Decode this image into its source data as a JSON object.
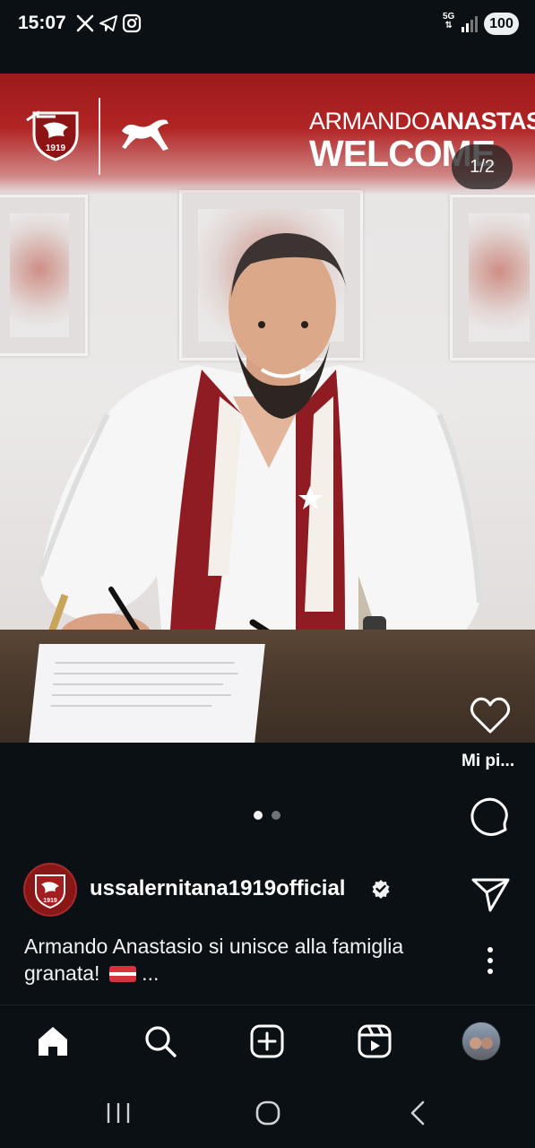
{
  "status_bar": {
    "time": "15:07",
    "network": "5G",
    "battery": "100",
    "icons": [
      "x-icon",
      "telegram-icon",
      "instagram-icon"
    ]
  },
  "post": {
    "image_counter": "1/2",
    "image_text": {
      "headline_first": "ARMANDO",
      "headline_last": "ANASTASIO",
      "headline_welcome": "WELCOME",
      "badge_year": "1919"
    },
    "like_label": "Mi pi...",
    "carousel": {
      "pages": 2,
      "active": 1
    },
    "author": "ussalernitana1919official",
    "caption_text": "Armando Anastasio si unisce alla famiglia granata!",
    "caption_more": " ..."
  },
  "nav": {
    "items": [
      "home-icon",
      "search-icon",
      "create-icon",
      "reels-icon",
      "profile-avatar"
    ]
  },
  "colors": {
    "background": "#0b1014",
    "club_red": "#9c1b1b",
    "text": "#ffffff"
  }
}
